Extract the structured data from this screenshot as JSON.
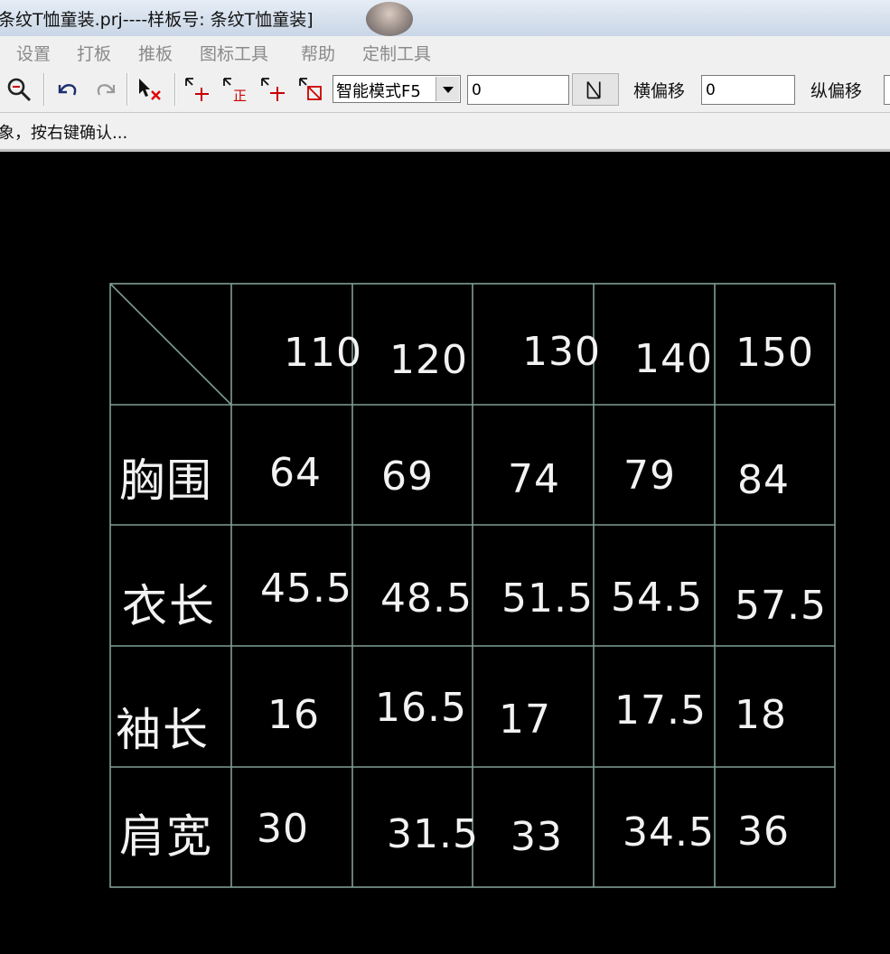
{
  "window": {
    "title": "条纹T恤童装.prj----样板号: 条纹T恤童装]"
  },
  "menu": [
    "设置",
    "打板",
    "推板",
    "图标工具",
    "帮助",
    "定制工具"
  ],
  "toolbar": {
    "icons": [
      "zoom-icon",
      "undo-icon",
      "redo-icon",
      "select-delete-icon",
      "move-point-icon",
      "align-point-icon",
      "add-point-icon",
      "delete-point-icon"
    ],
    "mode_select": "智能模式F5",
    "value_input": "0",
    "h_offset_label": "横偏移",
    "h_offset_value": "0",
    "v_offset_label": "纵偏移"
  },
  "status": {
    "message": "象，按右键确认..."
  },
  "table": {
    "sizes": [
      "110",
      "120",
      "130",
      "140",
      "150"
    ],
    "rows": [
      {
        "label": "胸围",
        "values": [
          "64",
          "69",
          "74",
          "79",
          "84"
        ]
      },
      {
        "label": "衣长",
        "values": [
          "45.5",
          "48.5",
          "51.5",
          "54.5",
          "57.5"
        ]
      },
      {
        "label": "袖长",
        "values": [
          "16",
          "16.5",
          "17",
          "17.5",
          "18"
        ]
      },
      {
        "label": "肩宽",
        "values": [
          "30",
          "31.5",
          "33",
          "34.5",
          "36"
        ]
      }
    ]
  },
  "colors": {
    "canvas": "#000000",
    "grid_line": "#7f9e96",
    "text": "#f2f2f2"
  }
}
